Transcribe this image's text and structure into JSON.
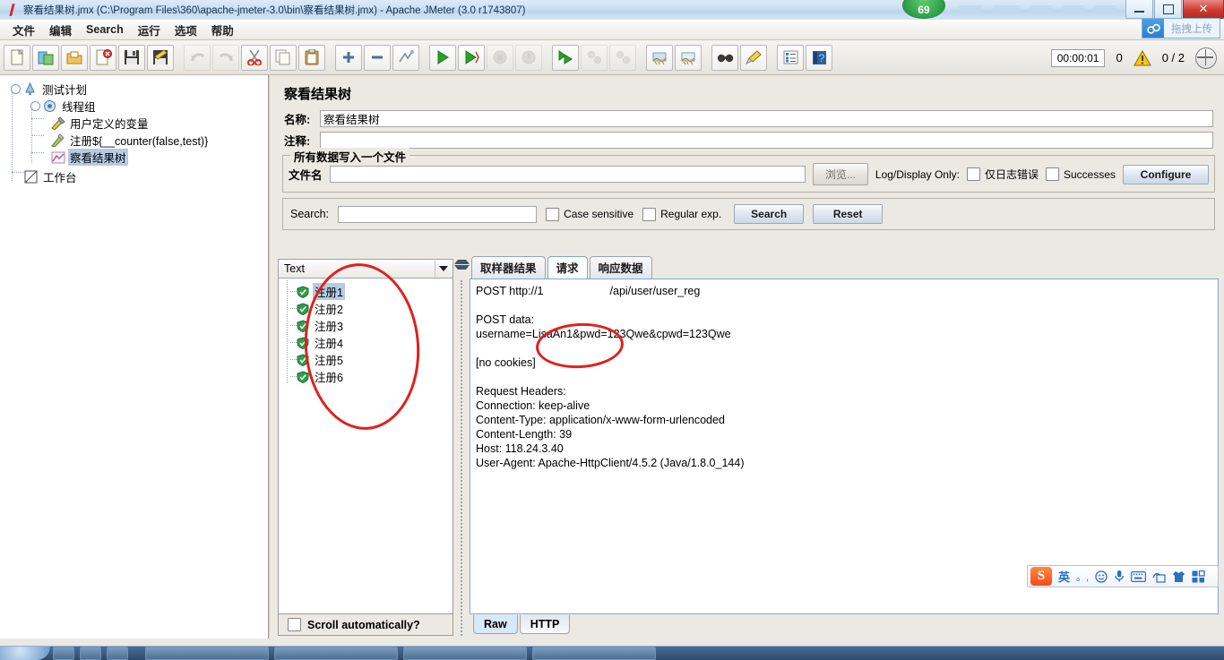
{
  "window": {
    "title": "察看结果树.jmx (C:\\Program Files\\360\\apache-jmeter-3.0\\bin\\察看结果树.jmx) - Apache JMeter (3.0 r1743807)",
    "badge_count": "69",
    "drag_upload_label": "拖拽上传",
    "minimize_label": "—",
    "restore_label": "❐",
    "close_label": "✕"
  },
  "menu": {
    "items": [
      "文件",
      "编辑",
      "Search",
      "运行",
      "选项",
      "帮助"
    ]
  },
  "toolbar": {
    "icons": [
      "new-file-icon",
      "new-test-plan-icon",
      "open-icon",
      "close-icon",
      "save-icon",
      "save-as-icon",
      "undo-icon",
      "redo-icon",
      "cut-icon",
      "copy-icon",
      "paste-icon",
      "expand-icon",
      "collapse-icon",
      "toggle-icon",
      "start-icon",
      "start-no-pause-icon",
      "stop-icon",
      "shutdown-icon",
      "start-remote-icon",
      "stop-remote-icon",
      "shutdown-remote-icon",
      "clear-icon",
      "clear-all-icon",
      "search-icon",
      "reset-search-icon",
      "function-helper-icon",
      "help-icon"
    ],
    "timer": "00:00:01",
    "error_count": "0",
    "warning_icon": "warning-triangle-icon",
    "threads": "0 / 2",
    "remote_icon": "globe-icon"
  },
  "tree": {
    "items": [
      {
        "label": "测试计划",
        "icon": "test-plan-icon",
        "depth": 0,
        "selected": false,
        "knob": true
      },
      {
        "label": "线程组",
        "icon": "thread-group-icon",
        "depth": 1,
        "selected": false,
        "knob": true
      },
      {
        "label": "用户定义的变量",
        "icon": "user-variables-icon",
        "depth": 2,
        "selected": false,
        "knob": false
      },
      {
        "label": "注册${__counter(false,test)}",
        "icon": "http-sampler-icon",
        "depth": 2,
        "selected": false,
        "knob": false
      },
      {
        "label": "察看结果树",
        "icon": "view-results-tree-icon",
        "depth": 2,
        "selected": true,
        "knob": false
      },
      {
        "label": "工作台",
        "icon": "workbench-icon",
        "depth": 0,
        "selected": false,
        "knob": false
      }
    ]
  },
  "panel": {
    "title": "察看结果树",
    "name_label": "名称:",
    "name_value": "察看结果树",
    "comment_label": "注释:",
    "comment_value": "",
    "filegroup": {
      "legend": "所有数据写入一个文件",
      "filename_label": "文件名",
      "filename_value": "",
      "browse_label": "浏览...",
      "logdisplay_label": "Log/Display Only:",
      "errors_only_label": "仅日志错误",
      "errors_only_checked": false,
      "successes_label": "Successes",
      "successes_checked": false,
      "configure_label": "Configure"
    },
    "search": {
      "label": "Search:",
      "value": "",
      "case_sensitive_label": "Case sensitive",
      "case_sensitive_checked": false,
      "regular_exp_label": "Regular exp.",
      "regular_exp_checked": false,
      "search_button": "Search",
      "reset_button": "Reset"
    }
  },
  "results": {
    "renderer_selected": "Text",
    "samples": [
      {
        "label": "注册1",
        "status": "success",
        "selected": true
      },
      {
        "label": "注册2",
        "status": "success",
        "selected": false
      },
      {
        "label": "注册3",
        "status": "success",
        "selected": false
      },
      {
        "label": "注册4",
        "status": "success",
        "selected": false
      },
      {
        "label": "注册5",
        "status": "success",
        "selected": false
      },
      {
        "label": "注册6",
        "status": "success",
        "selected": false
      }
    ],
    "scroll_auto_label": "Scroll automatically?",
    "scroll_auto_checked": false,
    "tabs": [
      {
        "label": "取样器结果",
        "active": false
      },
      {
        "label": "请求",
        "active": true
      },
      {
        "label": "响应数据",
        "active": false
      }
    ],
    "request_lines": [
      "POST http://11             /api/user/user_reg",
      "",
      "POST data:",
      "username=LisaAn1&pwd=123Qwe&cpwd=123Qwe",
      "",
      "[no cookies]",
      "",
      "Request Headers:",
      "Connection: keep-alive",
      "Content-Type: application/x-www-form-urlencoded",
      "Content-Length: 39",
      "Host: 118.24.3.40",
      "User-Agent: Apache-HttpClient/4.5.2 (Java/1.8.0_144)"
    ],
    "bottom_tabs": [
      {
        "label": "Raw",
        "active": true
      },
      {
        "label": "HTTP",
        "active": false
      }
    ]
  },
  "ime": {
    "logo": "S",
    "items": [
      {
        "icon": "chinese-english-toggle-icon",
        "label": "英"
      },
      {
        "icon": "punctuation-icon",
        "label": "。,"
      },
      {
        "icon": "emoji-icon",
        "label": "☺"
      },
      {
        "icon": "microphone-icon",
        "label": "🎤"
      },
      {
        "icon": "soft-keyboard-icon",
        "label": "⌨"
      },
      {
        "icon": "handwriting-icon",
        "label": "✍"
      },
      {
        "icon": "skin-icon",
        "label": "👕"
      },
      {
        "icon": "toolbox-icon",
        "label": "▦"
      }
    ]
  },
  "annotations": {
    "oval_samples": "red-ellipse-around-sample-list",
    "oval_username": "red-ellipse-around-username-param"
  },
  "colors": {
    "accent": "#2a6fc0",
    "selection": "#b5cbe3",
    "annotation": "#e02020",
    "success": "#2f9e48",
    "warning": "#f2c018"
  }
}
